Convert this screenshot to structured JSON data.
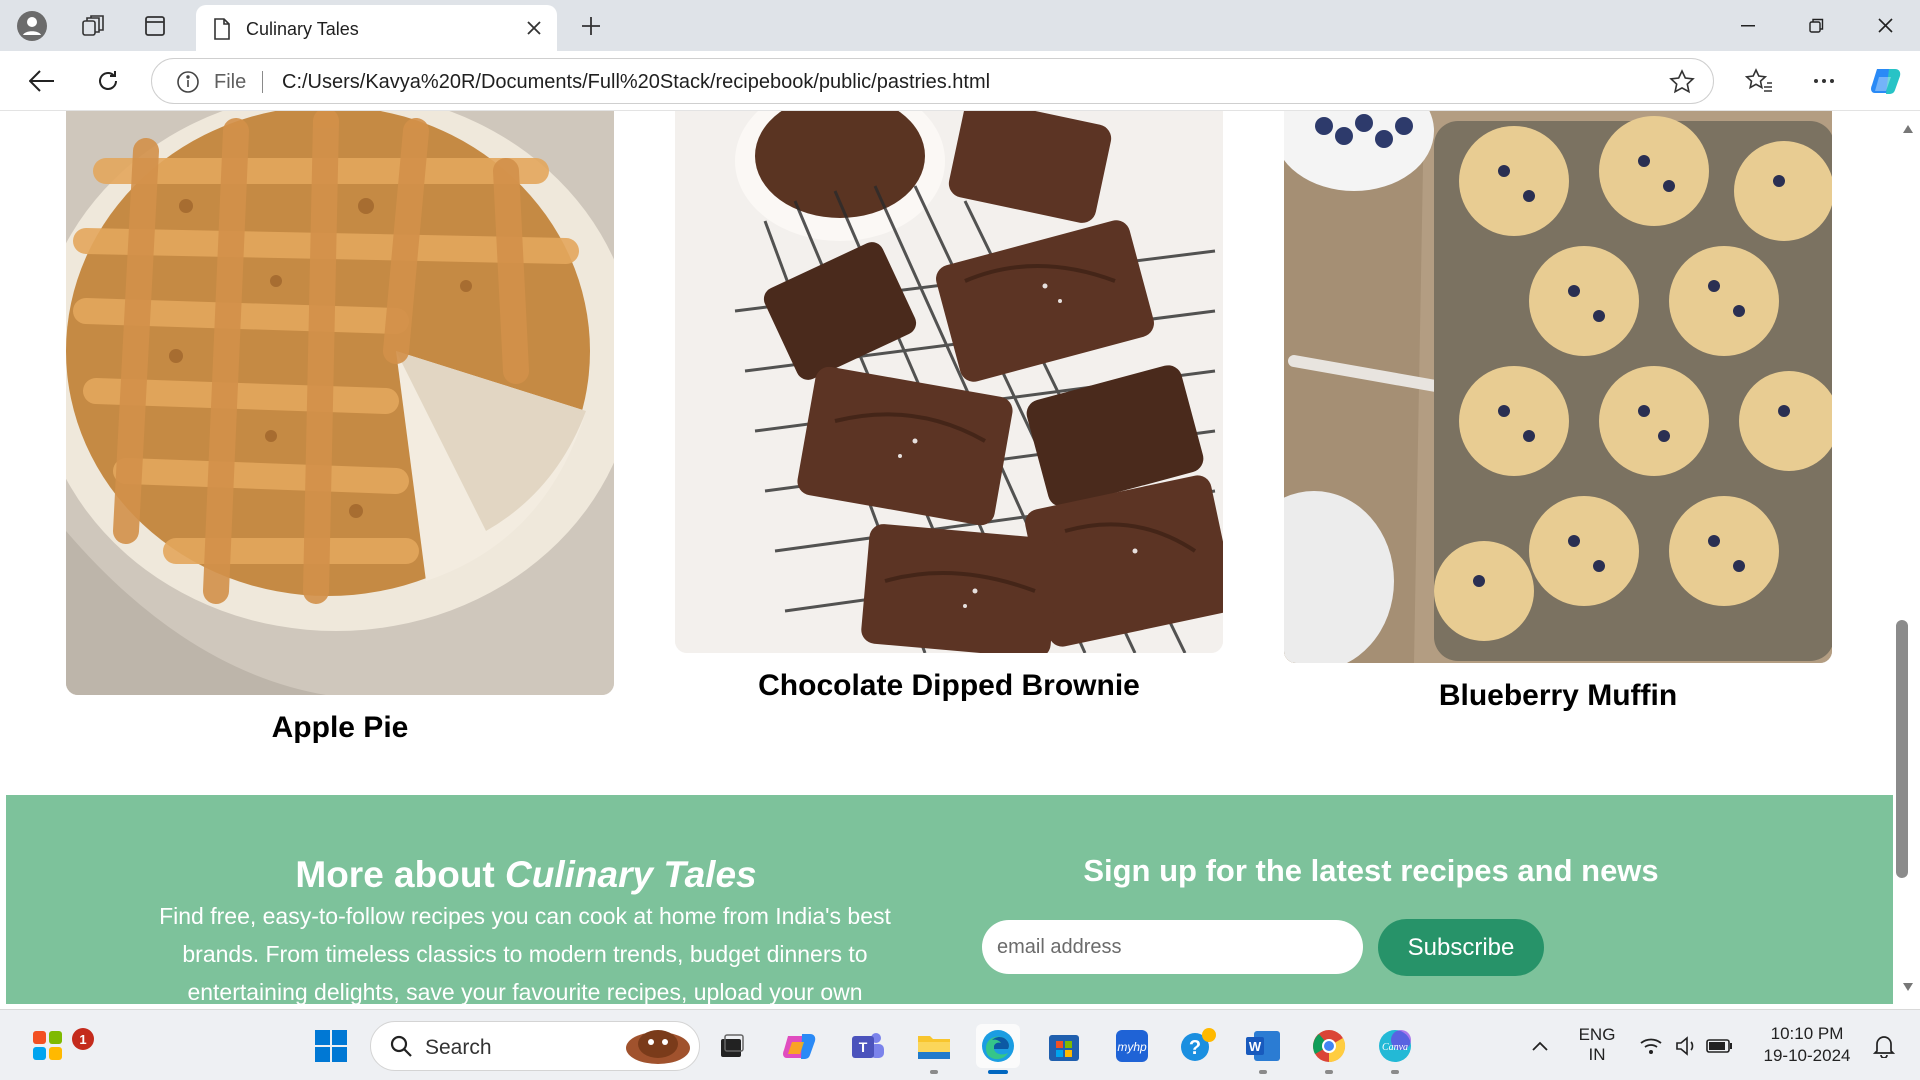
{
  "browser": {
    "tab_title": "Culinary Tales",
    "url_scheme_label": "File",
    "url": "C:/Users/Kavya%20R/Documents/Full%20Stack/recipebook/public/pastries.html"
  },
  "recipes": [
    {
      "title": "Apple Pie"
    },
    {
      "title": "Chocolate Dipped Brownie"
    },
    {
      "title": "Blueberry Muffin"
    }
  ],
  "footer": {
    "heading_prefix": "More about ",
    "heading_brand": "Culinary Tales",
    "description": "Find free, easy-to-follow recipes you can cook at home from India's best brands. From timeless classics to modern trends, budget dinners to entertaining delights, save your favourite recipes, upload your own",
    "signup_title": "Sign up for the latest recipes and news",
    "email_placeholder": "email address",
    "subscribe_label": "Subscribe",
    "background_color": "#7dc29b",
    "button_color": "#279369"
  },
  "taskbar": {
    "search_label": "Search",
    "notification_count": "1",
    "language": "ENG",
    "region": "IN",
    "time": "10:10 PM",
    "date": "19-10-2024",
    "apps": [
      "start-icon",
      "search",
      "file-explorer-icon",
      "copilot-icon",
      "teams-icon",
      "folder-icon",
      "edge-icon",
      "store-icon",
      "myhp-icon",
      "help-icon",
      "word-icon",
      "chrome-icon",
      "canva-icon"
    ]
  }
}
